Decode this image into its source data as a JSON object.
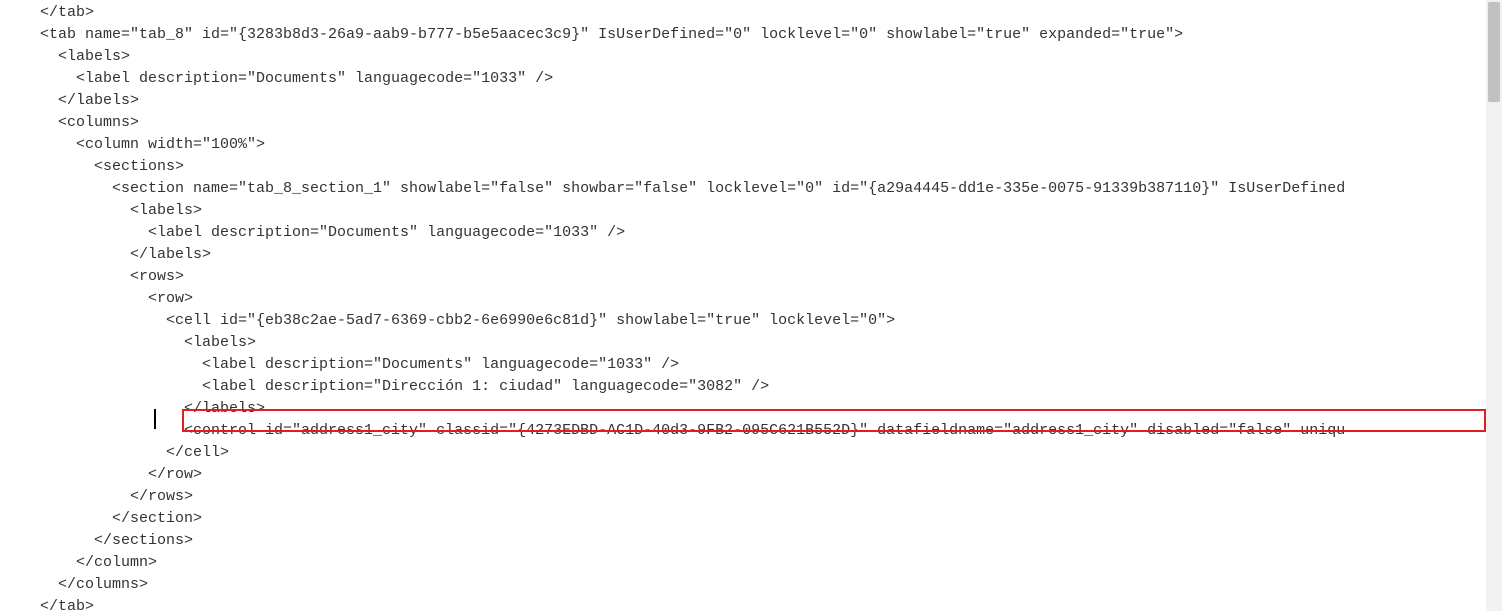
{
  "highlight_color": "#e31b23",
  "lines": [
    "</tab>",
    "<tab name=\"tab_8\" id=\"{3283b8d3-26a9-aab9-b777-b5e5aacec3c9}\" IsUserDefined=\"0\" locklevel=\"0\" showlabel=\"true\" expanded=\"true\">",
    "  <labels>",
    "    <label description=\"Documents\" languagecode=\"1033\" />",
    "  </labels>",
    "  <columns>",
    "    <column width=\"100%\">",
    "      <sections>",
    "        <section name=\"tab_8_section_1\" showlabel=\"false\" showbar=\"false\" locklevel=\"0\" id=\"{a29a4445-dd1e-335e-0075-91339b387110}\" IsUserDefined",
    "          <labels>",
    "            <label description=\"Documents\" languagecode=\"1033\" />",
    "          </labels>",
    "          <rows>",
    "            <row>",
    "              <cell id=\"{eb38c2ae-5ad7-6369-cbb2-6e6990e6c81d}\" showlabel=\"true\" locklevel=\"0\">",
    "                <labels>",
    "                  <label description=\"Documents\" languagecode=\"1033\" />",
    "                  <label description=\"Dirección 1: ciudad\" languagecode=\"3082\" />",
    "                </labels>",
    "                <control id=\"address1_city\" classid=\"{4273EDBD-AC1D-40d3-9FB2-095C621B552D}\" datafieldname=\"address1_city\" disabled=\"false\" uniqu",
    "              </cell>",
    "            </row>",
    "          </rows>",
    "        </section>",
    "      </sections>",
    "    </column>",
    "  </columns>",
    "</tab>"
  ]
}
